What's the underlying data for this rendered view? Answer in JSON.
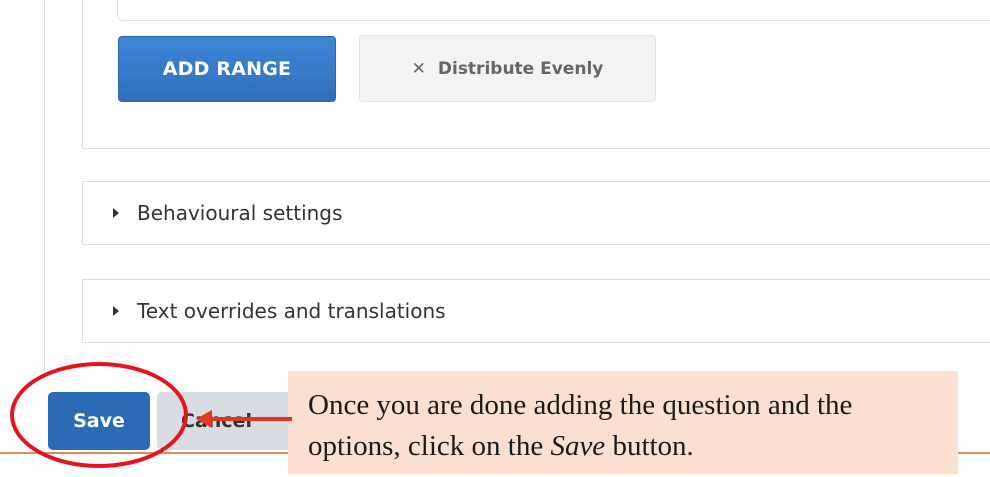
{
  "range_panel": {
    "add_range_label": "ADD RANGE",
    "distribute_icon": "close-x",
    "distribute_label": "Distribute Evenly"
  },
  "accordions": [
    {
      "label": "Behavioural settings",
      "icon": "caret-right"
    },
    {
      "label": "Text overrides and translations",
      "icon": "caret-right"
    }
  ],
  "footer": {
    "save_label": "Save",
    "cancel_label": "Cancel"
  },
  "annotation": {
    "text_before": "Once you are done adding the question and the options, click on the ",
    "text_emphasis": "Save",
    "text_after": " button.",
    "highlight_color": "#e8121b",
    "callout_bg": "#fbe0d1"
  },
  "colors": {
    "primary": "#2b6cb5",
    "secondary_bg": "#d8dde3"
  }
}
